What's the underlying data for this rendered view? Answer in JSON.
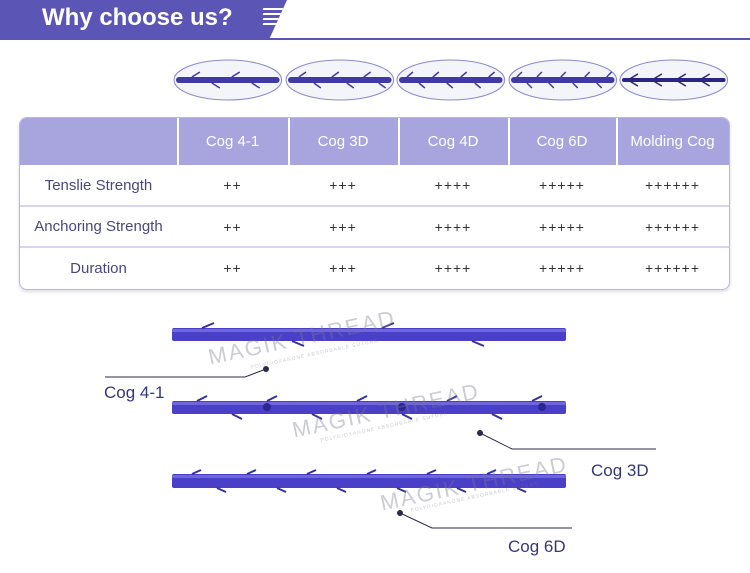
{
  "header": {
    "title": "Why choose us?"
  },
  "colors": {
    "accent": "#5b55b5",
    "table_header": "#a8a4dd",
    "thread": "#4a40c8"
  },
  "table": {
    "columns": [
      "Cog 4-1",
      "Cog 3D",
      "Cog 4D",
      "Cog 6D",
      "Molding Cog"
    ],
    "rows": [
      {
        "label": "Tenslie Strength",
        "values": [
          "++",
          "+++",
          "++++",
          "+++++",
          "++++++"
        ]
      },
      {
        "label": "Anchoring Strength",
        "values": [
          "++",
          "+++",
          "++++",
          "+++++",
          "++++++"
        ]
      },
      {
        "label": "Duration",
        "values": [
          "++",
          "+++",
          "++++",
          "+++++",
          "++++++"
        ]
      }
    ]
  },
  "thread_labels": {
    "cog41": "Cog 4-1",
    "cog3d": "Cog 3D",
    "cog6d": "Cog 6D"
  },
  "watermark": {
    "brand": "MAGIK THREAD",
    "sub": "POLYDIOXANONE ABSORBABLE SUTURE"
  }
}
